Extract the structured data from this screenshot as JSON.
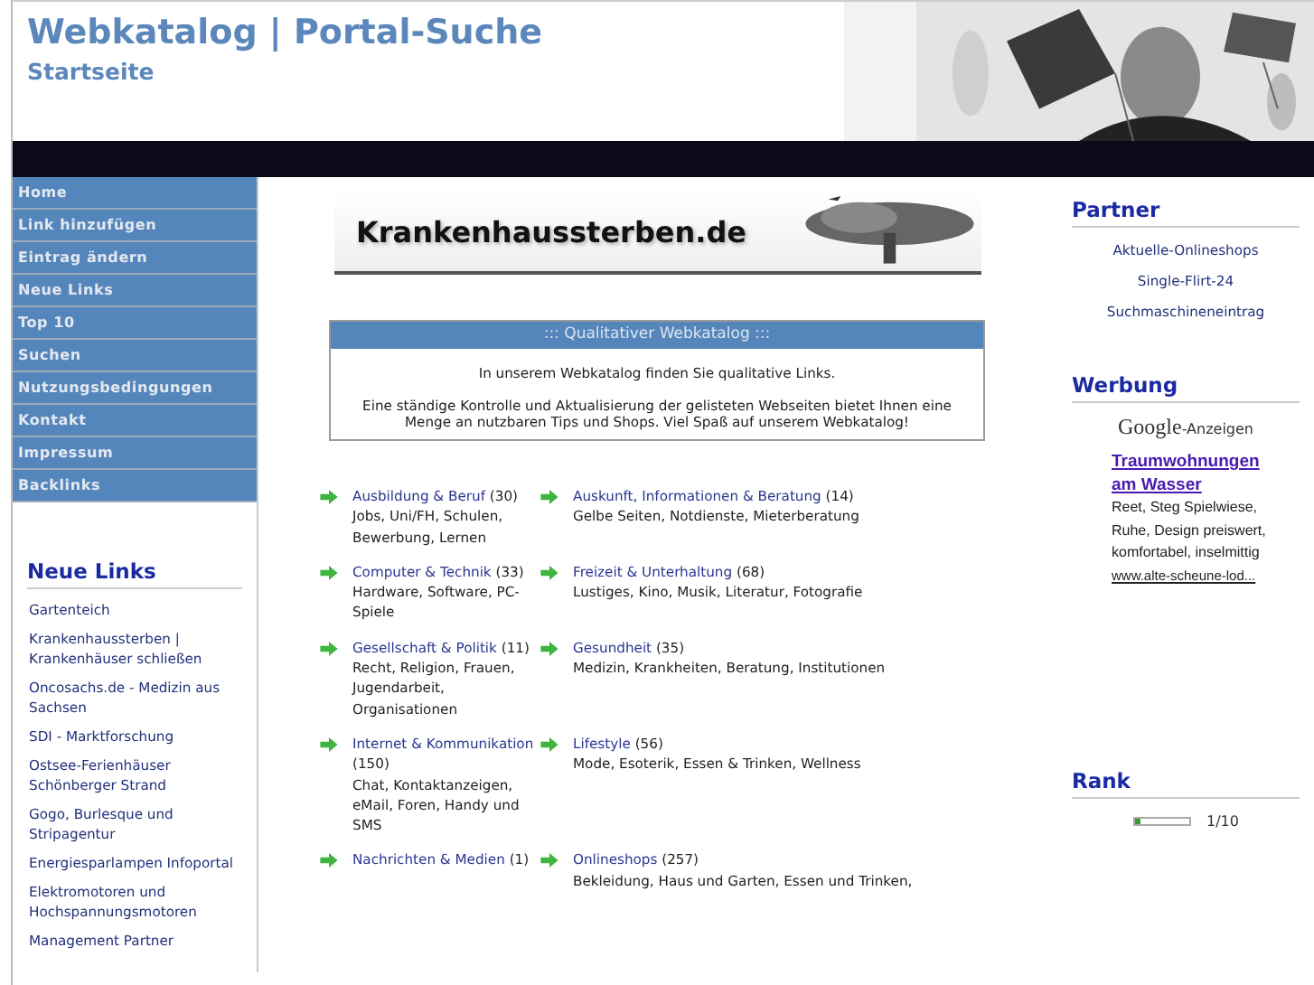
{
  "header": {
    "title": "Webkatalog | Portal-Suche",
    "subtitle": "Startseite",
    "kind": "picture"
  },
  "nav": [
    {
      "label": "Home"
    },
    {
      "label": "Link hinzufügen"
    },
    {
      "label": "Eintrag ändern"
    },
    {
      "label": "Neue Links"
    },
    {
      "label": "Top 10"
    },
    {
      "label": "Suchen"
    },
    {
      "label": "Nutzungsbedingungen"
    },
    {
      "label": "Kontakt"
    },
    {
      "label": "Impressum"
    },
    {
      "label": "Backlinks"
    }
  ],
  "new_links": {
    "title": "Neue Links",
    "items": [
      {
        "label": "Gartenteich"
      },
      {
        "label": "Krankenhaussterben | Krankenhäuser schließen"
      },
      {
        "label": "Oncosachs.de - Medizin aus Sachsen"
      },
      {
        "label": "SDI - Marktforschung"
      },
      {
        "label": "Ostsee-Ferienhäuser Schönberger Strand"
      },
      {
        "label": "Gogo, Burlesque und Stripagentur"
      },
      {
        "label": "Energiesparlampen Infoportal"
      },
      {
        "label": "Elektromotoren und Hochspannungsmotoren"
      },
      {
        "label": "Management Partner"
      }
    ]
  },
  "banner": {
    "text": "Krankenhaussterben.de"
  },
  "intro": {
    "title": "::: Qualitativer Webkatalog :::",
    "lines": [
      "In unserem Webkatalog finden Sie qualitative Links.",
      "Eine ständige Kontrolle und Aktualisierung der gelisteten Webseiten bietet Ihnen eine Menge an nutzbaren Tips und Shops. Viel Spaß auf unserem Webkatalog!"
    ]
  },
  "categories": [
    {
      "name": "Ausbildung & Beruf",
      "count": "(30)",
      "description": "Jobs, Uni/FH, Schulen, Bewerbung, Lernen"
    },
    {
      "name": "Auskunft, Informationen & Beratung",
      "count": "(14)",
      "description": "Gelbe Seiten, Notdienste, Mieterberatung"
    },
    {
      "name": "Computer & Technik",
      "count": "(33)",
      "description": "Hardware, Software, PC-Spiele"
    },
    {
      "name": "Freizeit & Unterhaltung",
      "count": "(68)",
      "description": "Lustiges, Kino, Musik, Literatur, Fotografie"
    },
    {
      "name": "Gesellschaft & Politik",
      "count": "(11)",
      "description": "Recht, Religion, Frauen, Jugendarbeit, Organisationen"
    },
    {
      "name": "Gesundheit",
      "count": "(35)",
      "description": "Medizin, Krankheiten, Beratung, Institutionen"
    },
    {
      "name": "Internet & Kommunikation",
      "count": "(150)",
      "description": "Chat, Kontaktanzeigen, eMail, Foren, Handy und SMS"
    },
    {
      "name": "Lifestyle",
      "count": "(56)",
      "description": "Mode, Esoterik, Essen & Trinken, Wellness"
    },
    {
      "name": "Nachrichten & Medien",
      "count": "(1)"
    },
    {
      "name": "Onlineshops",
      "count": "(257)",
      "description": "Bekleidung, Haus und Garten, Essen und Trinken,"
    }
  ],
  "partner": {
    "title": "Partner",
    "items": [
      {
        "label": "Aktuelle-Onlineshops"
      },
      {
        "label": "Single-Flirt-24"
      },
      {
        "label": "Suchmaschineneintrag"
      }
    ]
  },
  "werbung": {
    "title": "Werbung",
    "ads_brand": "Google",
    "ads_label": "-Anzeigen",
    "ad": {
      "title": "Traumwohnungen am Wasser",
      "text": "Reet, Steg Spielwiese, Ruhe, Design preiswert, komfortabel, inselmittig",
      "url": "www.alte-scheune-lod..."
    }
  },
  "rank": {
    "title": "Rank",
    "level": 0.1,
    "reading": "1/10"
  }
}
